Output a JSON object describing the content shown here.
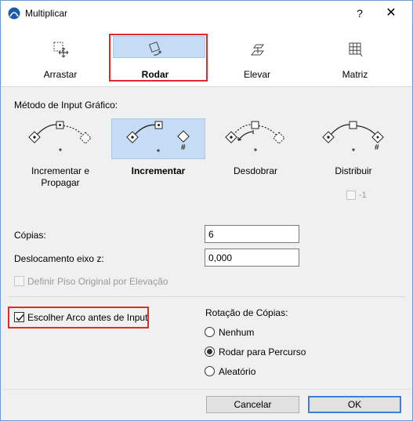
{
  "window": {
    "title": "Multiplicar",
    "help_label": "?",
    "close_label": "✕"
  },
  "modes": [
    {
      "label": "Arrastar",
      "icon": "drag-icon",
      "selected": false
    },
    {
      "label": "Rodar",
      "icon": "rotate-icon",
      "selected": true
    },
    {
      "label": "Elevar",
      "icon": "elevate-icon",
      "selected": false
    },
    {
      "label": "Matriz",
      "icon": "matrix-icon",
      "selected": false
    }
  ],
  "method": {
    "section_label": "Método de Input Gráfico:",
    "options": [
      {
        "label": "Incrementar e Propagar",
        "selected": false
      },
      {
        "label": "Incrementar",
        "selected": true
      },
      {
        "label": "Desdobrar",
        "selected": false
      },
      {
        "label": "Distribuir",
        "selected": false
      }
    ],
    "distribute_minus_one_label": "-1",
    "distribute_minus_one_checked": false
  },
  "fields": {
    "copies_label": "Cópias:",
    "copies_value": "6",
    "z_offset_label": "Deslocamento eixo z:",
    "z_offset_value": "0,000",
    "original_floor_label": "Definir Piso Original por Elevação",
    "original_floor_enabled": false
  },
  "arc": {
    "label": "Escolher Arco antes de Input",
    "checked": true
  },
  "rotation": {
    "section_label": "Rotação de Cópias:",
    "options": [
      {
        "label": "Nenhum",
        "selected": false
      },
      {
        "label": "Rodar para Percurso",
        "selected": true
      },
      {
        "label": "Aleatório",
        "selected": false
      }
    ]
  },
  "buttons": {
    "cancel_label": "Cancelar",
    "ok_label": "OK"
  },
  "colors": {
    "selection": "#c5dcf4",
    "highlight_red": "#e22a2a",
    "default_button_border": "#3c7fd4"
  }
}
